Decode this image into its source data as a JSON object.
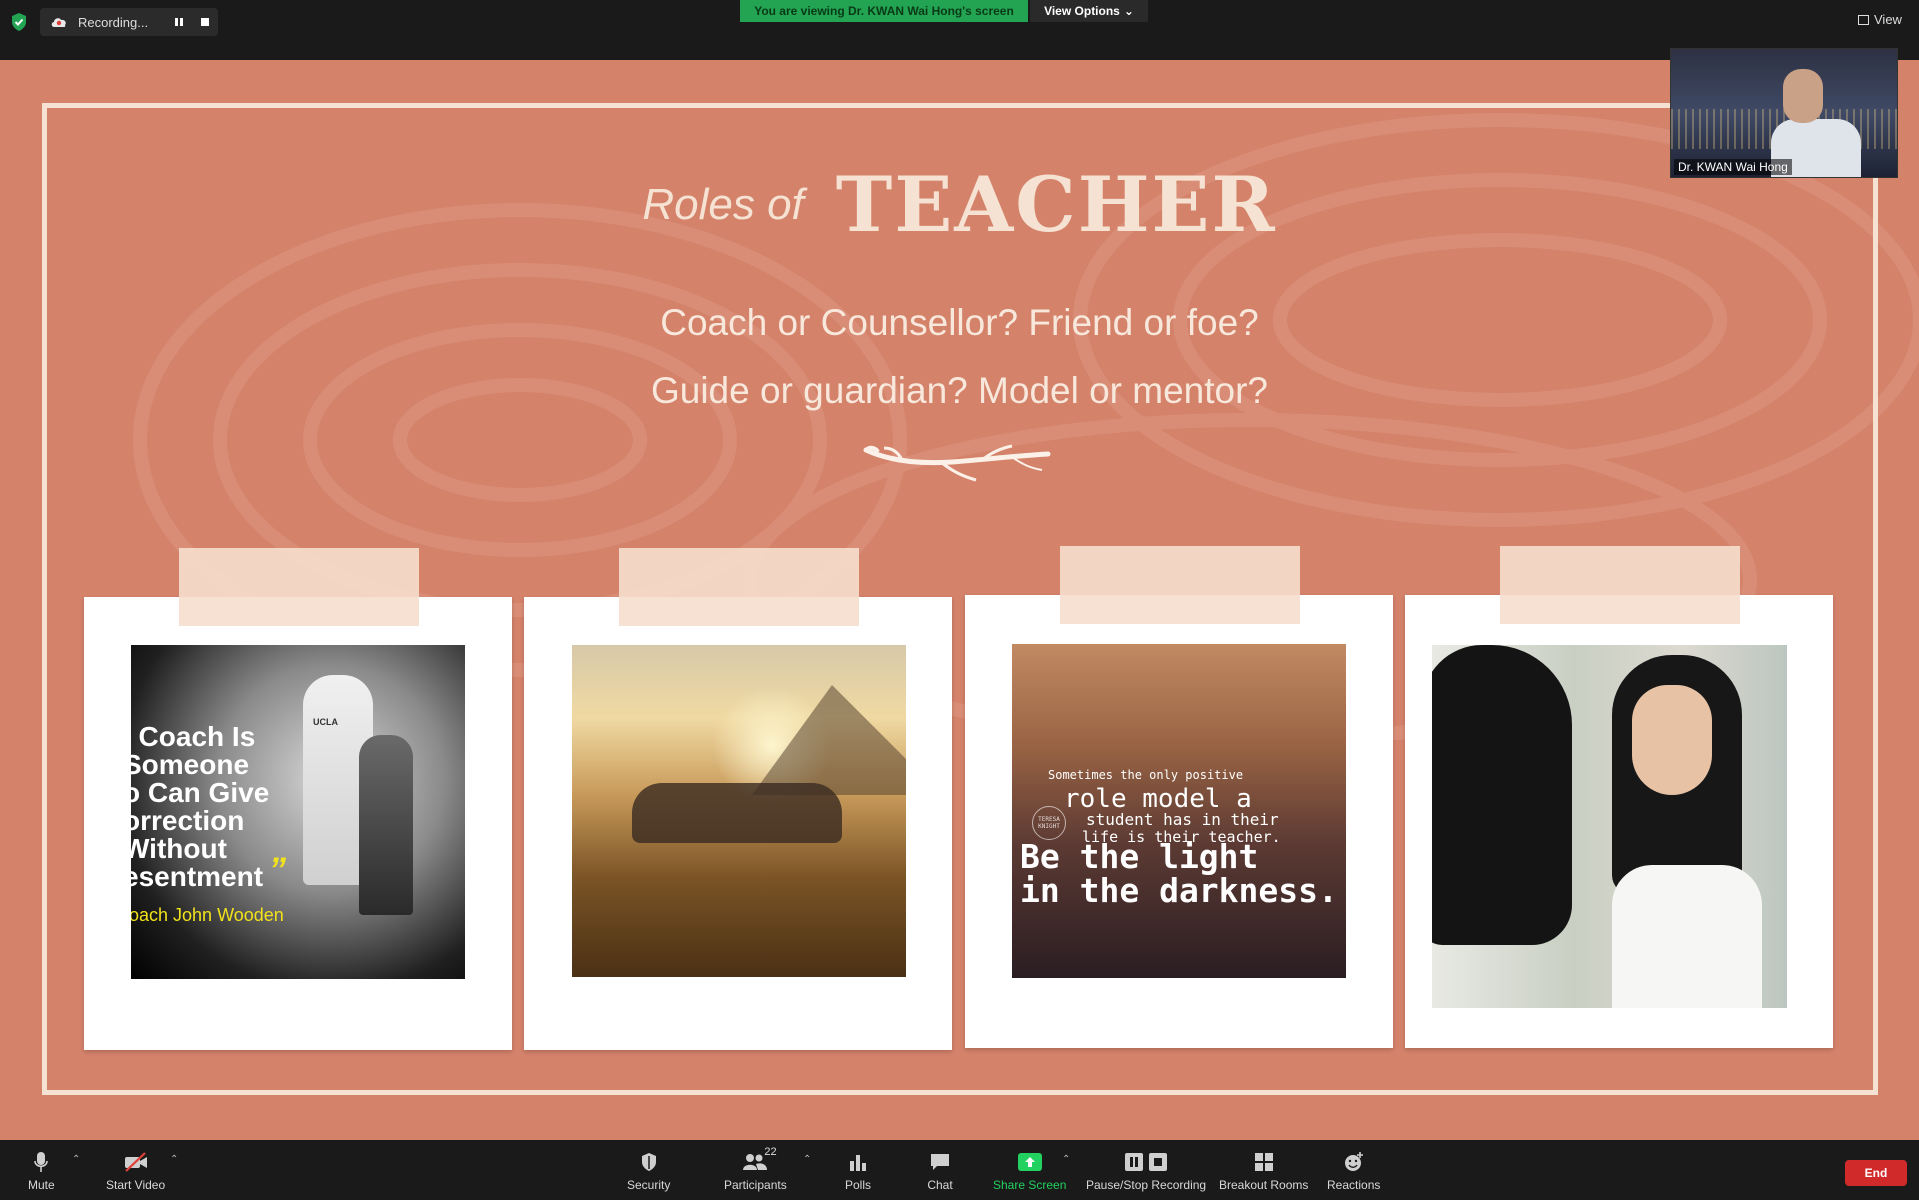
{
  "meeting": {
    "recording_label": "Recording...",
    "viewing_banner_prefix": "You are viewing ",
    "viewing_banner_name": "Dr. KWAN Wai Hong's screen",
    "view_options_label": "View Options",
    "view_label": "View",
    "speaker_name": "Dr. KWAN Wai Hong"
  },
  "slide": {
    "title_prefix": "Roles of",
    "title_main": "TEACHER",
    "line1": "Coach or Counsellor? Friend or  foe?",
    "line2": "Guide or guardian? Model or mentor?",
    "photo1_quote": ". Coach Is\nSomeone\no Can Give\norrection\nWithout\nesentment",
    "photo1_author": "oach John Wooden",
    "photo1_jersey": "UCLA",
    "photo3_line1": "Sometimes the only positive",
    "photo3_line2": "role model a",
    "photo3_line3": "student has in their",
    "photo3_line4": "life is their teacher.",
    "photo3_line5": "Be the light\nin the darkness.",
    "photo3_stamp": "TERESA KNIGHT",
    "colors": {
      "background": "#d4826a",
      "frame": "#f6e2d2",
      "tape": "#f6decd"
    }
  },
  "toolbar": {
    "mute_label": "Mute",
    "start_video_label": "Start Video",
    "security_label": "Security",
    "participants_label": "Participants",
    "participants_count": "22",
    "polls_label": "Polls",
    "chat_label": "Chat",
    "share_screen_label": "Share Screen",
    "pause_stop_label": "Pause/Stop Recording",
    "breakout_label": "Breakout Rooms",
    "reactions_label": "Reactions",
    "end_label": "End",
    "accent_green": "#23d160",
    "end_red": "#d12a2a"
  }
}
